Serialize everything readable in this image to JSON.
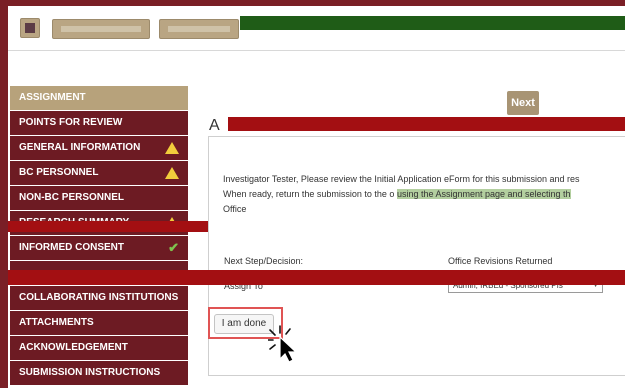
{
  "toolbar": {
    "icon_button": "toolbar-icon",
    "buttons": [
      "",
      ""
    ]
  },
  "sidebar": {
    "items": [
      {
        "label": "ASSIGNMENT",
        "active": true,
        "status": ""
      },
      {
        "label": "POINTS FOR REVIEW",
        "active": false,
        "status": ""
      },
      {
        "label": "GENERAL INFORMATION",
        "active": false,
        "status": "warning-icon"
      },
      {
        "label": "BC PERSONNEL",
        "active": false,
        "status": "warning-icon"
      },
      {
        "label": "NON-BC PERSONNEL",
        "active": false,
        "status": ""
      },
      {
        "label": "RESEARCH SUMMARY",
        "active": false,
        "status": "warning-icon"
      },
      {
        "label": "INFORMED CONSENT",
        "active": false,
        "status": "check-icon"
      },
      {
        "label": "",
        "active": false,
        "status": ""
      },
      {
        "label": "COLLABORATING INSTITUTIONS",
        "active": false,
        "status": ""
      },
      {
        "label": "ATTACHMENTS",
        "active": false,
        "status": ""
      },
      {
        "label": "ACKNOWLEDGEMENT",
        "active": false,
        "status": ""
      },
      {
        "label": "SUBMISSION INSTRUCTIONS",
        "active": false,
        "status": ""
      }
    ]
  },
  "main": {
    "next_label": "Next",
    "title": "A",
    "instructions": {
      "line1": "Investigator Tester, Please review the Initial Application eForm for this submission and res",
      "line2a": "When ready, return the submission to the o",
      "line2b": "using the Assignment page and selecting th",
      "line3": "Office"
    },
    "next_step_label": "Next Step/Decision:",
    "next_step_value": "Office Revisions Returned",
    "assign_label": "Assign To",
    "assign_value": "Admin, IRBEd - Sponsored PIs",
    "done_label": "I am done"
  },
  "colors": {
    "maroon": "#6d1b23",
    "gold": "#b7a27b",
    "redaction": "#a30f12",
    "highlight_green": "#b3cf9f"
  }
}
